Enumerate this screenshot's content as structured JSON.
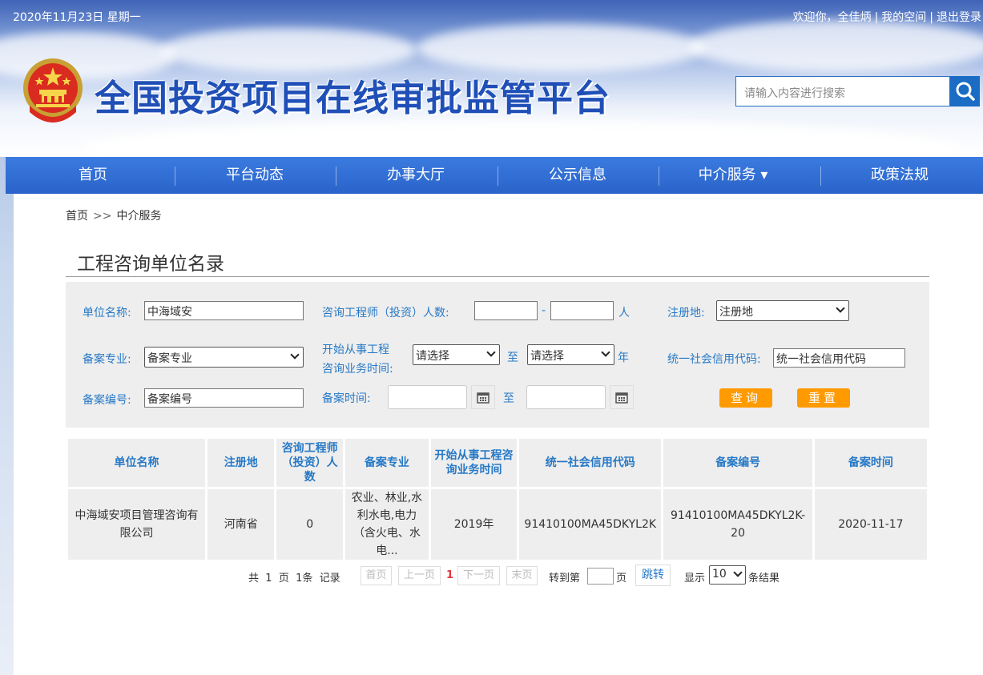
{
  "header": {
    "date": "2020年11月23日 星期一",
    "welcome": "欢迎你，全佳炳",
    "my_space": "我的空间",
    "logout": "退出登录",
    "site_title": "全国投资项目在线审批监管平台",
    "search_placeholder": "请输入内容进行搜索"
  },
  "nav": {
    "items": [
      "首页",
      "平台动态",
      "办事大厅",
      "公示信息",
      "中介服务 ▾",
      "政策法规"
    ]
  },
  "breadcrumb": {
    "home": "首页",
    "sep": ">>",
    "current": "中介服务"
  },
  "page_title": "工程咨询单位名录",
  "filters": {
    "unit_name_label": "单位名称:",
    "unit_name_value": "中海域安",
    "engineer_count_label": "咨询工程师（投资）人数:",
    "dash": "-",
    "person_unit": "人",
    "reg_place_label": "注册地:",
    "reg_place_value": "注册地",
    "specialty_label": "备案专业:",
    "specialty_value": "备案专业",
    "start_time_label_1": "开始从事工程",
    "start_time_label_2": "咨询业务时间:",
    "start_from_value": "请选择",
    "to_label": "至",
    "start_to_value": "请选择",
    "year_unit": "年",
    "credit_code_label": "统一社会信用代码:",
    "credit_code_placeholder": "统一社会信用代码",
    "record_no_label": "备案编号:",
    "record_no_placeholder": "备案编号",
    "record_time_label": "备案时间:",
    "record_to_label": "至",
    "query_button": "查询",
    "reset_button": "重置"
  },
  "table": {
    "headers": [
      "单位名称",
      "注册地",
      "咨询工程师（投资）人数",
      "备案专业",
      "开始从事工程咨询业务时间",
      "统一社会信用代码",
      "备案编号",
      "备案时间"
    ],
    "rows": [
      [
        "中海域安项目管理咨询有限公司",
        "河南省",
        "0",
        "农业、林业,水利水电,电力（含火电、水电...",
        "2019年",
        "91410100MA45DKYL2K",
        "91410100MA45DKYL2K-20",
        "2020-11-17"
      ]
    ]
  },
  "pager": {
    "total_prefix": "共",
    "total_pages": "1",
    "page_unit": "页",
    "records": "1条",
    "records_suffix": "记录",
    "first": "首页",
    "prev": "上一页",
    "current": "1",
    "next": "下一页",
    "last": "末页",
    "goto_label": "转到第",
    "goto_unit": "页",
    "jump_button": "跳转",
    "show_label": "显示",
    "page_size": "10",
    "results_label": "条结果"
  },
  "colors": {
    "accent": "#2779c6",
    "nav": "#2a63c9",
    "button_orange": "#ff9a00",
    "current_page": "#e4393c"
  }
}
